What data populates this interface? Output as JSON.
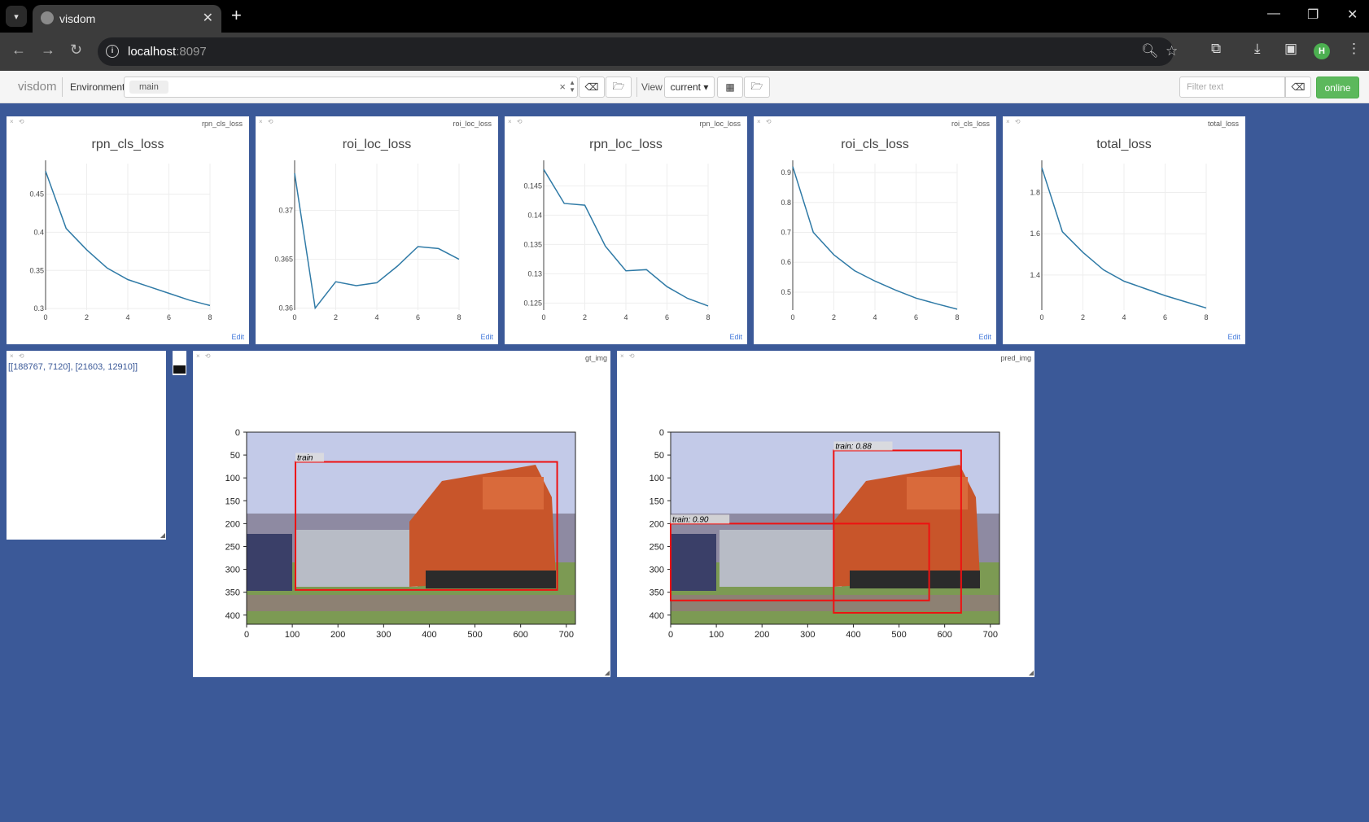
{
  "browser": {
    "tab_title": "visdom",
    "url_host": "localhost",
    "url_port": ":8097",
    "profile_initial": "H"
  },
  "toolbar": {
    "brand": "visdom",
    "environment_label": "Environment",
    "environment_value": "main",
    "view_label": "View",
    "view_value": "current ▾",
    "filter_placeholder": "Filter text",
    "online_label": "online"
  },
  "panes": {
    "text_pane": {
      "content": "[[188767, 7120], [21603, 12910]]"
    },
    "gt_img": {
      "title": "gt_img",
      "box_labels": [
        "train"
      ]
    },
    "pred_img": {
      "title": "pred_img",
      "box_labels": [
        "train: 0.88",
        "train: 0.90"
      ]
    },
    "edit_label": "Edit"
  },
  "chart_data": [
    {
      "id": "rpn_cls_loss",
      "type": "line",
      "title": "rpn_cls_loss",
      "x": [
        0,
        1,
        2,
        3,
        4,
        5,
        6,
        7,
        8
      ],
      "y": [
        0.48,
        0.405,
        0.377,
        0.353,
        0.338,
        0.329,
        0.32,
        0.311,
        0.304
      ],
      "xlim": [
        0,
        8
      ],
      "ylim": [
        0.298,
        0.49
      ],
      "xticks": [
        0,
        2,
        4,
        6,
        8
      ],
      "yticks": [
        0.3,
        0.35,
        0.4,
        0.45
      ],
      "ytick_labels": [
        "0.3",
        "0.35",
        "0.4",
        "0.45"
      ]
    },
    {
      "id": "roi_loc_loss",
      "type": "line",
      "title": "roi_loc_loss",
      "x": [
        0,
        1,
        2,
        3,
        4,
        5,
        6,
        7,
        8
      ],
      "y": [
        0.3738,
        0.36,
        0.3627,
        0.3623,
        0.3626,
        0.3643,
        0.3663,
        0.3661,
        0.365
      ],
      "xlim": [
        0,
        8
      ],
      "ylim": [
        0.3598,
        0.3748
      ],
      "xticks": [
        0,
        2,
        4,
        6,
        8
      ],
      "yticks": [
        0.36,
        0.365,
        0.37
      ],
      "ytick_labels": [
        "0.36",
        "0.365",
        "0.37"
      ]
    },
    {
      "id": "rpn_loc_loss",
      "type": "line",
      "title": "rpn_loc_loss",
      "x": [
        0,
        1,
        2,
        3,
        4,
        5,
        6,
        7,
        8
      ],
      "y": [
        0.1478,
        0.142,
        0.1417,
        0.1347,
        0.1305,
        0.1307,
        0.1278,
        0.1258,
        0.1245
      ],
      "xlim": [
        0,
        8
      ],
      "ylim": [
        0.1238,
        0.1488
      ],
      "xticks": [
        0,
        2,
        4,
        6,
        8
      ],
      "yticks": [
        0.125,
        0.13,
        0.135,
        0.14,
        0.145
      ],
      "ytick_labels": [
        "0.125",
        "0.13",
        "0.135",
        "0.14",
        "0.145"
      ]
    },
    {
      "id": "roi_cls_loss",
      "type": "line",
      "title": "roi_cls_loss",
      "x": [
        0,
        1,
        2,
        3,
        4,
        5,
        6,
        7,
        8
      ],
      "y": [
        0.92,
        0.7,
        0.625,
        0.572,
        0.537,
        0.507,
        0.48,
        0.461,
        0.443
      ],
      "xlim": [
        0,
        8
      ],
      "ylim": [
        0.44,
        0.93
      ],
      "xticks": [
        0,
        2,
        4,
        6,
        8
      ],
      "yticks": [
        0.5,
        0.6,
        0.7,
        0.8,
        0.9
      ],
      "ytick_labels": [
        "0.5",
        "0.6",
        "0.7",
        "0.8",
        "0.9"
      ]
    },
    {
      "id": "total_loss",
      "type": "line",
      "title": "total_loss",
      "x": [
        0,
        1,
        2,
        3,
        4,
        5,
        6,
        7,
        8
      ],
      "y": [
        1.92,
        1.61,
        1.51,
        1.425,
        1.37,
        1.335,
        1.3,
        1.27,
        1.24
      ],
      "xlim": [
        0,
        8
      ],
      "ylim": [
        1.23,
        1.94
      ],
      "xticks": [
        0,
        2,
        4,
        6,
        8
      ],
      "yticks": [
        1.4,
        1.6,
        1.8
      ],
      "ytick_labels": [
        "1.4",
        "1.6",
        "1.8"
      ]
    }
  ],
  "image_axes": {
    "xticks": [
      0,
      100,
      200,
      300,
      400,
      500,
      600,
      700
    ],
    "yticks": [
      0,
      50,
      100,
      150,
      200,
      250,
      300,
      350,
      400
    ],
    "width": 720,
    "height": 420
  }
}
